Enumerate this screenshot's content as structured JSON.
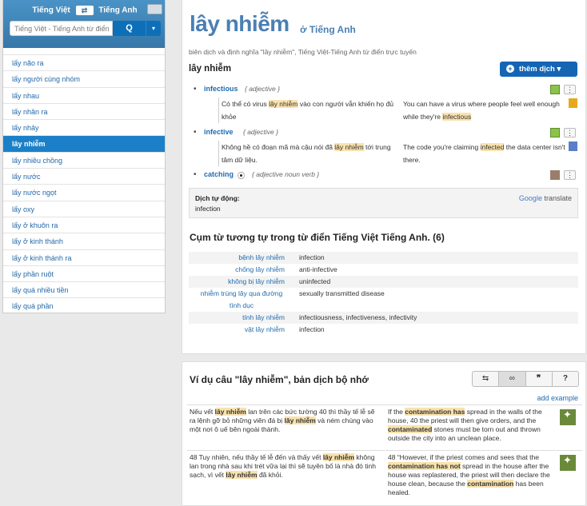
{
  "header": {
    "lang_from": "Tiếng Việt",
    "lang_to": "Tiếng Anh",
    "swap_glyph": "⇄",
    "search_placeholder": "Tiếng Việt - Tiếng Anh từ điển",
    "search_icon": "Q",
    "dropdown_icon": "▾"
  },
  "sidebar": {
    "items": [
      "lấy não ra",
      "lấy người cùng nhóm",
      "lấy nhau",
      "lấy nhân ra",
      "lấy nhảy",
      "lây nhiễm",
      "lấy nhiều chồng",
      "lấy nước",
      "lấy nước ngọt",
      "lấy oxy",
      "lấy ở khuôn ra",
      "lấy ở kinh thánh",
      "lấy ở kinh thánh ra",
      "lấy phần ruột",
      "lấy quá nhiều tiền",
      "lấy quá phần"
    ],
    "active_index": 5
  },
  "entry": {
    "word": "lây nhiễm",
    "lang_label": "ở Tiếng Anh",
    "subtitle": "biên dịch và định nghĩa \"lây nhiễm\", Tiếng Việt-Tiếng Anh từ điển trực tuyến",
    "section_title": "lây nhiễm",
    "add_button": "thêm dịch",
    "translations": [
      {
        "word": "infectious",
        "pos": "{ adjective }",
        "ex_vi_pre": "Có thể có virus ",
        "ex_vi_hl": "lây nhiễm",
        "ex_vi_post": " vào con người vẫn khiến họ đủ khỏe",
        "ex_en_pre": "You can have a virus where people feel well enough while they're ",
        "ex_en_hl": "infectious"
      },
      {
        "word": "infective",
        "pos": "{ adjective }",
        "ex_vi_pre": "Không hề có đoạn mã mà cậu nói đã ",
        "ex_vi_hl": "lây nhiễm",
        "ex_vi_post": " tới trung tâm dữ liệu.",
        "ex_en_pre": "The code you're claiming ",
        "ex_en_hl": "infected",
        "ex_en_post": " the data center isn't there."
      },
      {
        "word": "catching",
        "pos": "{ adjective noun verb }",
        "play_icon": "⦿"
      }
    ],
    "menu_icon": "⋮",
    "auto": {
      "label": "Dịch tự động:",
      "value": "infection",
      "google": "Google",
      "translate": "translate"
    },
    "phrases_title": "Cụm từ tương tự trong từ điển Tiếng Việt Tiếng Anh. (6)",
    "phrases": [
      {
        "vi": "bệnh lây nhiễm",
        "en": "infection"
      },
      {
        "vi": "chống lây nhiễm",
        "en": "anti-infective"
      },
      {
        "vi": "không bị lây nhiễm",
        "en": "uninfected"
      },
      {
        "vi": "nhiễm trùng lây qua đường tình dục",
        "en": "sexually transmitted disease"
      },
      {
        "vi": "tính lây nhiễm",
        "en": "infectiousness, infectiveness, infectivity"
      },
      {
        "vi": "vật lây nhiễm",
        "en": "infection"
      }
    ]
  },
  "examples": {
    "title": "Ví dụ câu \"lây nhiễm\", bản dịch bộ nhớ",
    "tabs": [
      "⇆",
      "∞",
      "❞",
      "?"
    ],
    "add_label": "add example",
    "rows": [
      {
        "vi": [
          "Nếu vết ",
          "lây nhiễm",
          " lan trên các bức tường 40 thì thầy tế lễ sẽ ra lệnh gỡ bỏ những viên đá bị ",
          "lây nhiễm",
          " và ném chúng vào một nơi ô uế bên ngoài thành."
        ],
        "en": [
          "If the ",
          "contamination has",
          " spread in the walls of the house, 40 the priest will then give orders, and the ",
          "contaminated",
          " stones must be torn out and thrown outside the city into an unclean place."
        ]
      },
      {
        "vi": [
          "48 Tuy nhiên, nếu thầy tế lễ đến và thấy vết ",
          "lây nhiễm",
          " không lan trong nhà sau khi trét vữa lại thì sẽ tuyên bố là nhà đó tinh sạch, vì vết ",
          "lây nhiễm",
          " đã khỏi."
        ],
        "en": [
          "48 “However, if the priest comes and sees that the ",
          "contamination has not",
          " spread in the house after the house was replastered, the priest will then declare the house clean, because the ",
          "contamination",
          " has been healed."
        ]
      }
    ]
  },
  "colors": {
    "accent": "#1565b5",
    "highlight": "#f9e2ad",
    "sidebar_active": "#1c80c8"
  }
}
